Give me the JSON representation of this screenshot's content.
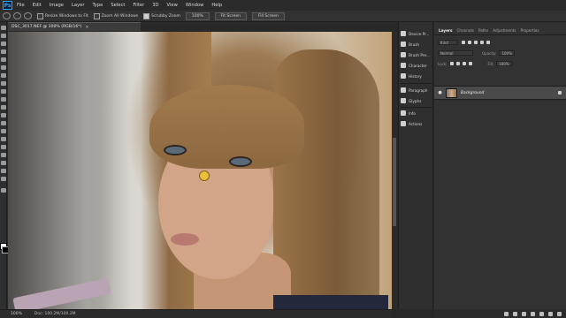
{
  "app": {
    "logo_text": "Ps"
  },
  "menu": [
    "File",
    "Edit",
    "Image",
    "Layer",
    "Type",
    "Select",
    "Filter",
    "3D",
    "View",
    "Window",
    "Help"
  ],
  "options_bar": {
    "resize_windows_label": "Resize Windows to Fit",
    "resize_windows_checked": false,
    "zoom_all_label": "Zoom All Windows",
    "zoom_all_checked": false,
    "scrubby_zoom_label": "Scrubby Zoom",
    "scrubby_zoom_checked": true,
    "zoom_value": "100%",
    "fit_screen_label": "Fit Screen",
    "fill_screen_label": "Fill Screen"
  },
  "document": {
    "tab_title": "DSC_3017.NEF @ 100% (RGB/16*)",
    "close_glyph": "×"
  },
  "status_bar": {
    "zoom": "100%",
    "doc_size": "Doc: 100.2M/100.2M"
  },
  "dock_panels": [
    {
      "label": "Device Pr...",
      "icon": "device-preview-icon"
    },
    {
      "label": "Brush",
      "icon": "brush-icon"
    },
    {
      "label": "Brush Pre...",
      "icon": "brush-presets-icon"
    },
    {
      "label": "Character",
      "icon": "character-icon"
    },
    {
      "label": "History",
      "icon": "history-icon"
    },
    {
      "label": "Paragraph",
      "icon": "paragraph-icon"
    },
    {
      "label": "Glyphs",
      "icon": "glyphs-icon"
    },
    {
      "label": "Info",
      "icon": "info-icon"
    },
    {
      "label": "Actions",
      "icon": "actions-icon"
    }
  ],
  "layers_panel": {
    "tabs": [
      "Layers",
      "Channels",
      "Paths",
      "Adjustments",
      "Properties"
    ],
    "active_tab": "Layers",
    "kind_filter": "Kind",
    "blend_mode": "Normal",
    "opacity_label": "Opacity:",
    "opacity_value": "100%",
    "lock_label": "Lock:",
    "fill_label": "Fill:",
    "fill_value": "100%",
    "layer_name": "Background"
  }
}
